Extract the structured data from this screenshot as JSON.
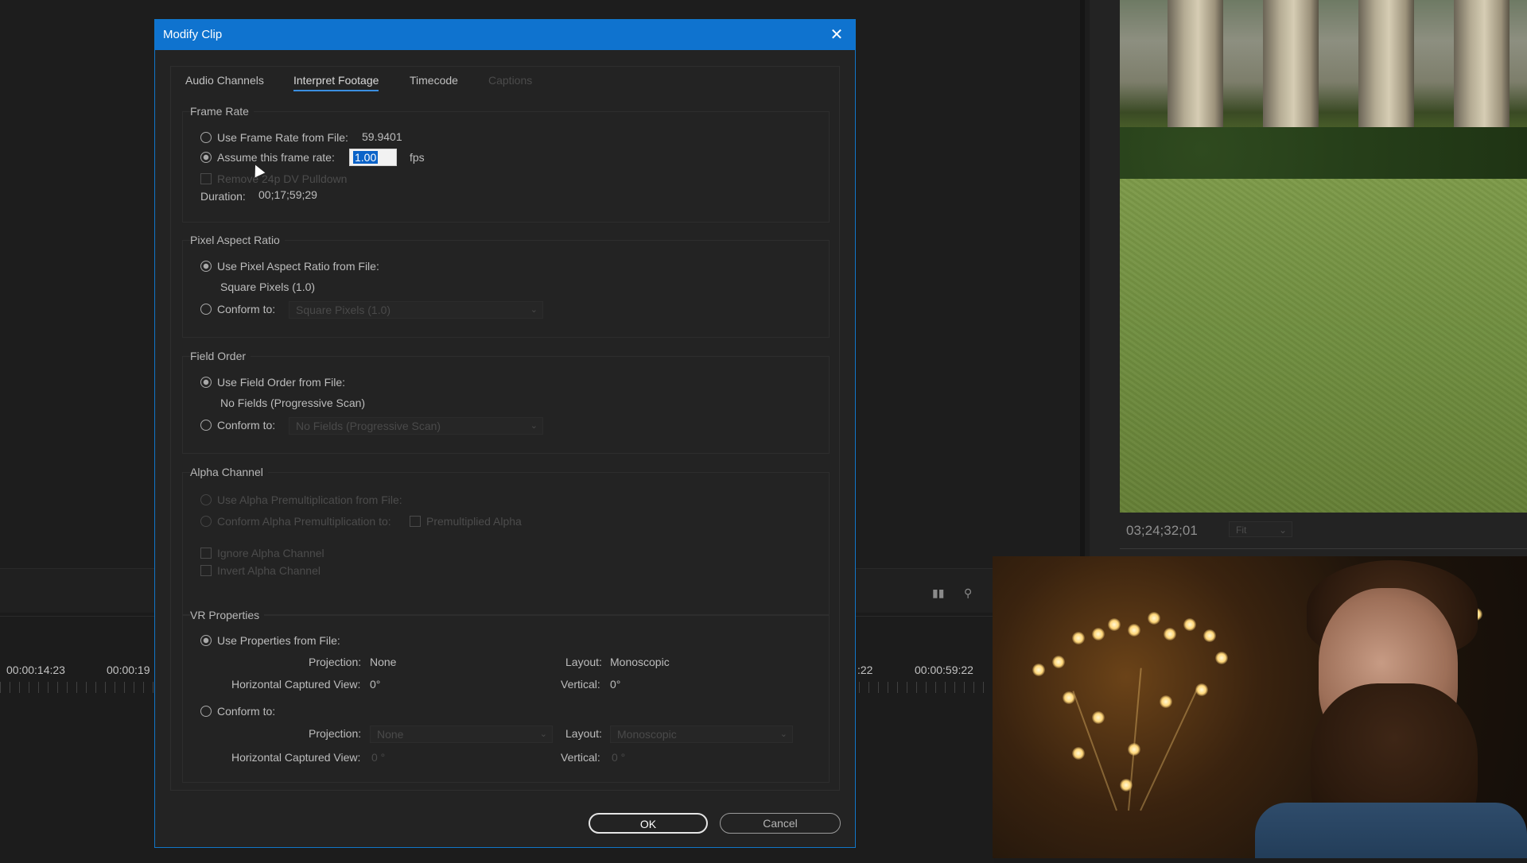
{
  "dialog": {
    "title": "Modify Clip",
    "tabs": [
      {
        "label": "Audio Channels"
      },
      {
        "label": "Interpret Footage"
      },
      {
        "label": "Timecode"
      },
      {
        "label": "Captions"
      }
    ],
    "frame_rate": {
      "heading": "Frame Rate",
      "use_from_file_label": "Use Frame Rate from File:",
      "file_rate": "59.9401",
      "assume_label": "Assume this frame rate:",
      "assume_value": "1.00",
      "fps_unit": "fps",
      "remove_pulldown_label": "Remove 24p DV Pulldown",
      "duration_label": "Duration:",
      "duration_value": "00;17;59;29"
    },
    "pixel_aspect": {
      "heading": "Pixel Aspect Ratio",
      "use_from_file_label": "Use Pixel Aspect Ratio from File:",
      "file_value": "Square Pixels (1.0)",
      "conform_label": "Conform to:",
      "conform_value": "Square Pixels (1.0)"
    },
    "field_order": {
      "heading": "Field Order",
      "use_from_file_label": "Use Field Order from File:",
      "file_value": "No Fields (Progressive Scan)",
      "conform_label": "Conform to:",
      "conform_value": "No Fields (Progressive Scan)"
    },
    "alpha": {
      "heading": "Alpha Channel",
      "use_from_file_label": "Use Alpha Premultiplication from File:",
      "conform_label": "Conform Alpha Premultiplication to:",
      "premultiplied_label": "Premultiplied Alpha",
      "ignore_label": "Ignore Alpha Channel",
      "invert_label": "Invert Alpha Channel"
    },
    "vr": {
      "heading": "VR Properties",
      "use_from_file_label": "Use Properties from File:",
      "projection_label": "Projection:",
      "projection_value": "None",
      "layout_label": "Layout:",
      "layout_value": "Monoscopic",
      "hview_label": "Horizontal Captured View:",
      "hview_value": "0°",
      "vertical_label": "Vertical:",
      "vertical_value": "0°",
      "conform_label": "Conform to:",
      "conform_projection_value": "None",
      "conform_layout_value": "Monoscopic",
      "conform_hview_value": "0 °",
      "conform_vertical_value": "0 °"
    },
    "ok_label": "OK",
    "cancel_label": "Cancel"
  },
  "background": {
    "program_timecode": "03;24;32;01",
    "fit_label": "Fit",
    "timeline_times": [
      "00:00:14:23",
      "00:00:19",
      ":22",
      "00:00:59:22"
    ]
  },
  "colors": {
    "accent": "#0f73cf",
    "dialog_bg": "#232323"
  },
  "icons": {
    "close": "close-icon",
    "chevron": "chevron-down-icon",
    "search": "search-icon",
    "settings": "wrench-icon"
  }
}
